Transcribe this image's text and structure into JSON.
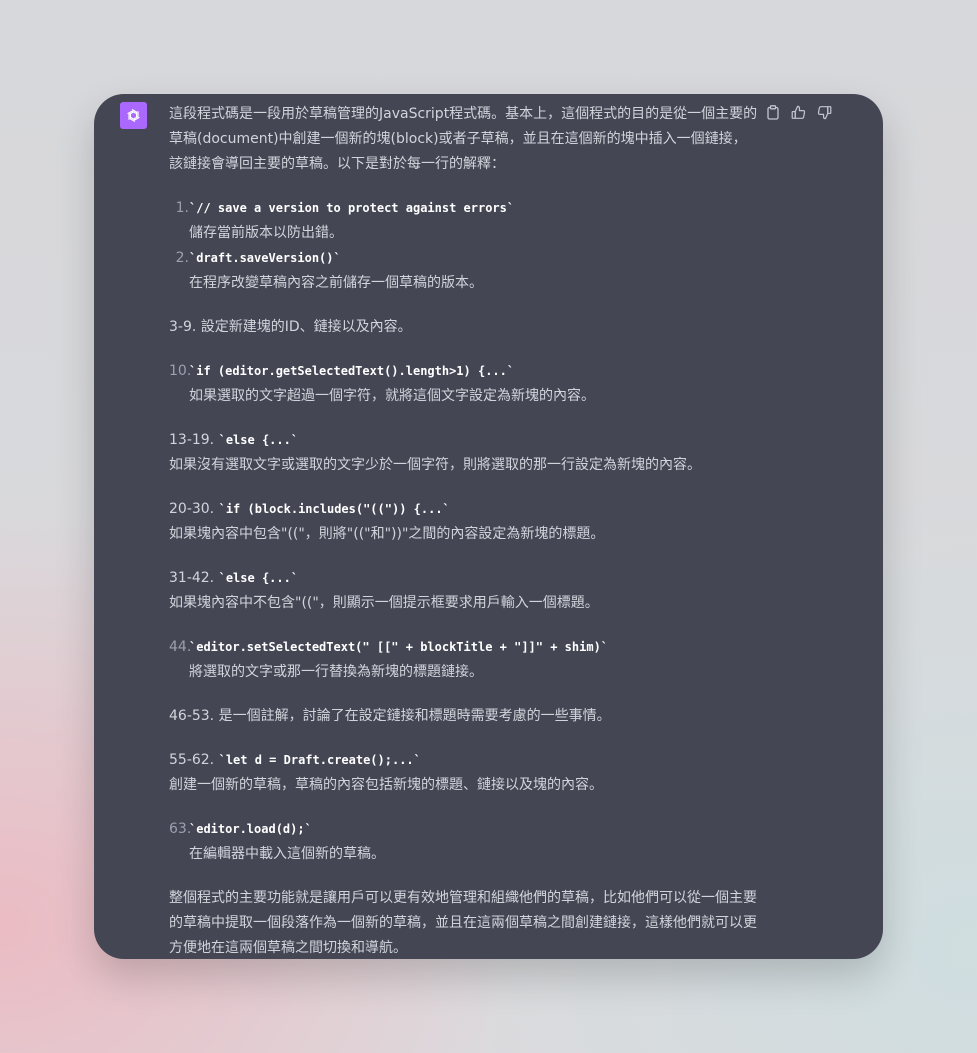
{
  "colors": {
    "avatar": "#ab68ff",
    "card": "#444654",
    "text": "#d1d5db",
    "code": "#ffffff"
  },
  "icons": {
    "avatar": "openai-logo-icon",
    "copy": "clipboard-icon",
    "like": "thumbs-up-icon",
    "dislike": "thumbs-down-icon"
  },
  "message": {
    "intro": "這段程式碼是一段用於草稿管理的JavaScript程式碼。基本上，這個程式的目的是從一個主要的草稿(document)中創建一個新的塊(block)或者子草稿，並且在這個新的塊中插入一個鏈接，該鏈接會導回主要的草稿。以下是對於每一行的解釋：",
    "item1": {
      "num": "1.",
      "code": "`// save a version to protect against errors`",
      "desc": "儲存當前版本以防出錯。"
    },
    "item2": {
      "num": "2.",
      "code": "`draft.saveVersion()`",
      "desc": "在程序改變草稿內容之前儲存一個草稿的版本。"
    },
    "range_3_9": "3-9. 設定新建塊的ID、鏈接以及內容。",
    "item10": {
      "num": "10.",
      "code": "`if (editor.getSelectedText().length>1) {...`",
      "desc": "如果選取的文字超過一個字符，就將這個文字設定為新塊的內容。"
    },
    "range_13_19": {
      "label": "13-19.",
      "code": "`else {...`",
      "desc": "如果沒有選取文字或選取的文字少於一個字符，則將選取的那一行設定為新塊的內容。"
    },
    "range_20_30": {
      "label": "20-30.",
      "code": "`if (block.includes(\"((\")) {...`",
      "desc": "如果塊內容中包含\"((\"，則將\"((\"和\"))\"之間的內容設定為新塊的標題。"
    },
    "range_31_42": {
      "label": "31-42.",
      "code": "`else {...`",
      "desc": "如果塊內容中不包含\"((\"，則顯示一個提示框要求用戶輸入一個標題。"
    },
    "item44": {
      "num": "44.",
      "code": "`editor.setSelectedText(\" [[\" + blockTitle + \"]]\" + shim)`",
      "desc": "將選取的文字或那一行替換為新塊的標題鏈接。"
    },
    "range_46_53": "46-53. 是一個註解，討論了在設定鏈接和標題時需要考慮的一些事情。",
    "range_55_62": {
      "label": "55-62.",
      "code": "`let d = Draft.create();...`",
      "desc": "創建一個新的草稿，草稿的內容包括新塊的標題、鏈接以及塊的內容。"
    },
    "item63": {
      "num": "63.",
      "code": "`editor.load(d);`",
      "desc": "在編輯器中載入這個新的草稿。"
    },
    "summary": "整個程式的主要功能就是讓用戶可以更有效地管理和組織他們的草稿，比如他們可以從一個主要的草稿中提取一個段落作為一個新的草稿，並且在這兩個草稿之間創建鏈接，這樣他們就可以更方便地在這兩個草稿之間切換和導航。"
  }
}
